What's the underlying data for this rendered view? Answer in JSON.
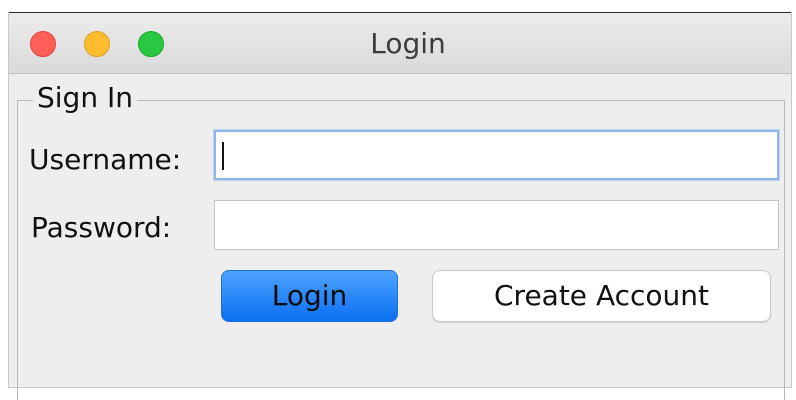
{
  "window": {
    "title": "Login"
  },
  "group": {
    "legend": "Sign In"
  },
  "form": {
    "username_label": "Username:",
    "username_value": "",
    "password_label": "Password:",
    "password_value": ""
  },
  "buttons": {
    "login_label": "Login",
    "create_account_label": "Create Account"
  },
  "colors": {
    "close": "#fe5f57",
    "minimize": "#febc2e",
    "maximize": "#28c840",
    "primary_button": "#0a6ff2",
    "focus_ring": "#8db5e8"
  }
}
